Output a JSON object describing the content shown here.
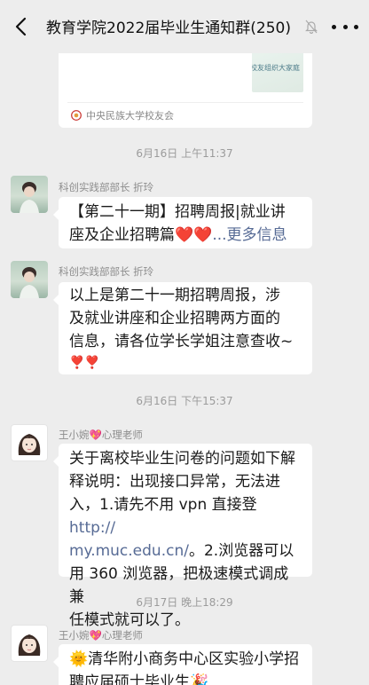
{
  "header": {
    "title": "教育学院2022届毕业生通知群(250)",
    "back_icon": "chevron-left-icon",
    "mute_icon": "bell-muted-icon",
    "more_icon": "more-dots-icon"
  },
  "card": {
    "thumb_text": "校友组织大家庭",
    "source": "中央民族大学校友会"
  },
  "messages": [
    {
      "time": "6月16日 上午11:37",
      "sender": "科创实践部部长 折玲",
      "text_a": "【第二十一期】招聘周报|就业讲",
      "text_b": "座及企业招聘篇",
      "emoji": "❤️❤️",
      "more": "...更多信息"
    },
    {
      "sender": "科创实践部部长 折玲",
      "lines": [
        "以上是第二十一期招聘周报，涉",
        "及就业讲座和企业招聘两方面的",
        "信息，请各位学长学姐注意查收~"
      ],
      "emoji": "❣️❣️"
    },
    {
      "time": "6月16日 下午15:37",
      "sender_name": "王小婉",
      "sender_suffix": "心理老师",
      "sender_emoji": "💖",
      "line1": "关于离校毕业生问卷的问题如下解",
      "line2": "释说明：出现接口异常，无法进",
      "line3": "入，1.请先不用 vpn 直接登 ",
      "link_a": "http://",
      "link_b": "my.muc.edu.cn/",
      "line4_rest": "。2.浏览器可以",
      "line5": "用 360 浏览器，把极速模式调成兼",
      "line6": "任模式就可以了。"
    },
    {
      "time": "6月17日 晚上18:29",
      "sender_name": "王小婉",
      "sender_suffix": "心理老师",
      "sender_emoji": "💖",
      "lead_emoji": "🌞",
      "line1": "清华附小商务中心区实验小学招",
      "line2": "聘应届硕士毕业生",
      "tail_emoji": "🎉"
    }
  ]
}
